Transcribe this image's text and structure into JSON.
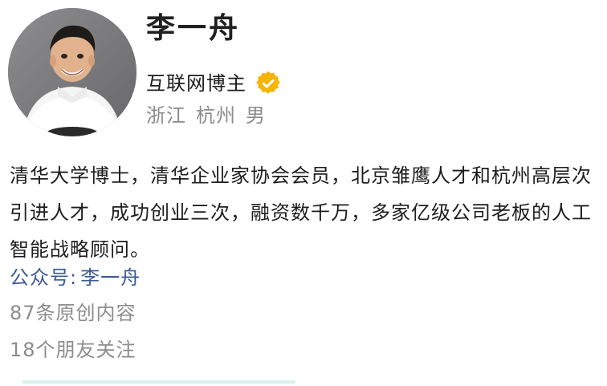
{
  "profile": {
    "name": "李一舟",
    "title": "互联网博主",
    "location": [
      "浙江",
      "杭州",
      "男"
    ],
    "bio": "清华大学博士，清华企业家协会会员，北京雏鹰人才和杭州高层次引进人才，成功创业三次，融资数千万，多家亿级公司老板的人工智能战略顾问。",
    "official_account": {
      "label": "公众号:",
      "value": "李一舟"
    },
    "stats": {
      "original_content": "87条原创内容",
      "friends_following": "18个朋友关注"
    }
  },
  "colors": {
    "verified": "#f5b500",
    "account_link": "#3a5a95",
    "secondary_text": "#8c8c8c"
  },
  "icons": {
    "avatar": "avatar",
    "verified": "verified-badge-icon"
  }
}
